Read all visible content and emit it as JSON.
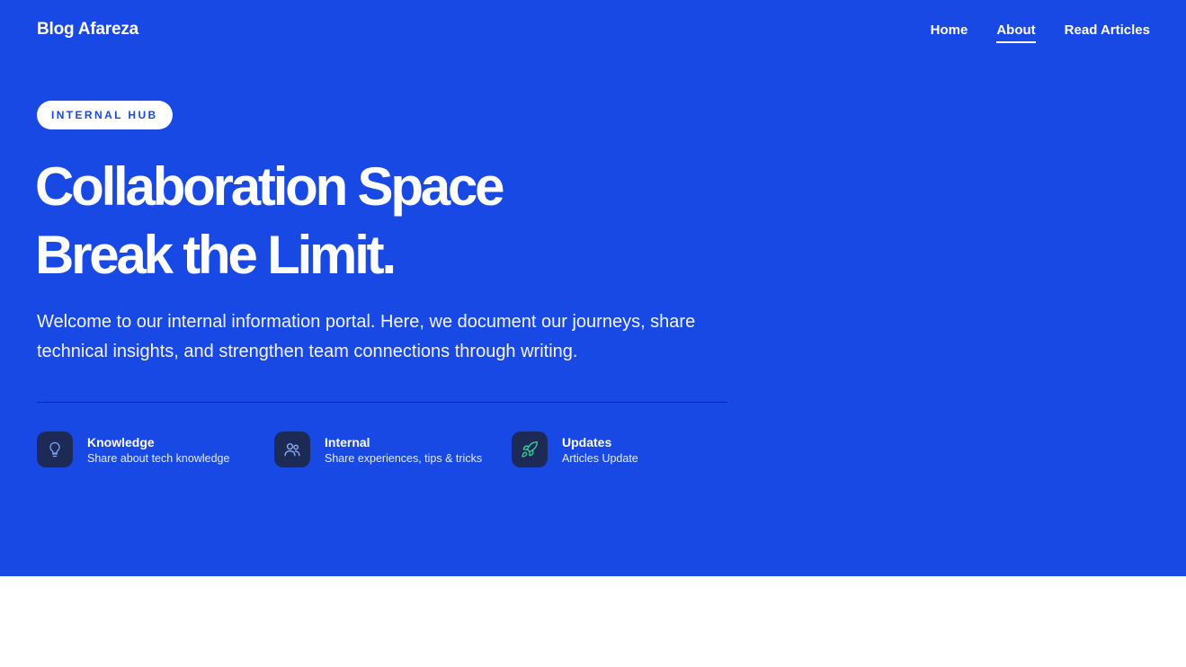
{
  "nav": {
    "brand": "Blog Afareza",
    "links": [
      {
        "label": "Home"
      },
      {
        "label": "About"
      },
      {
        "label": "Read Articles"
      }
    ]
  },
  "hero": {
    "badge": "INTERNAL HUB",
    "headline_line1": "Collaboration Space",
    "headline_line2": "Break the Limit.",
    "intro": "Welcome to our internal information portal. Here, we document our journeys, share technical insights, and strengthen team connections through writing."
  },
  "features": [
    {
      "title": "Knowledge",
      "subtitle": "Share about tech knowledge",
      "icon": "lightbulb-icon"
    },
    {
      "title": "Internal",
      "subtitle": "Share experiences, tips & tricks",
      "icon": "users-icon"
    },
    {
      "title": "Updates",
      "subtitle": "Articles Update",
      "icon": "rocket-icon"
    }
  ],
  "colors": {
    "hero_bg": "#1849e5",
    "icon_tile": "#1d2a55",
    "lightbulb": "#7ea6ff",
    "users": "#8fb0ff",
    "rocket": "#34d399"
  }
}
